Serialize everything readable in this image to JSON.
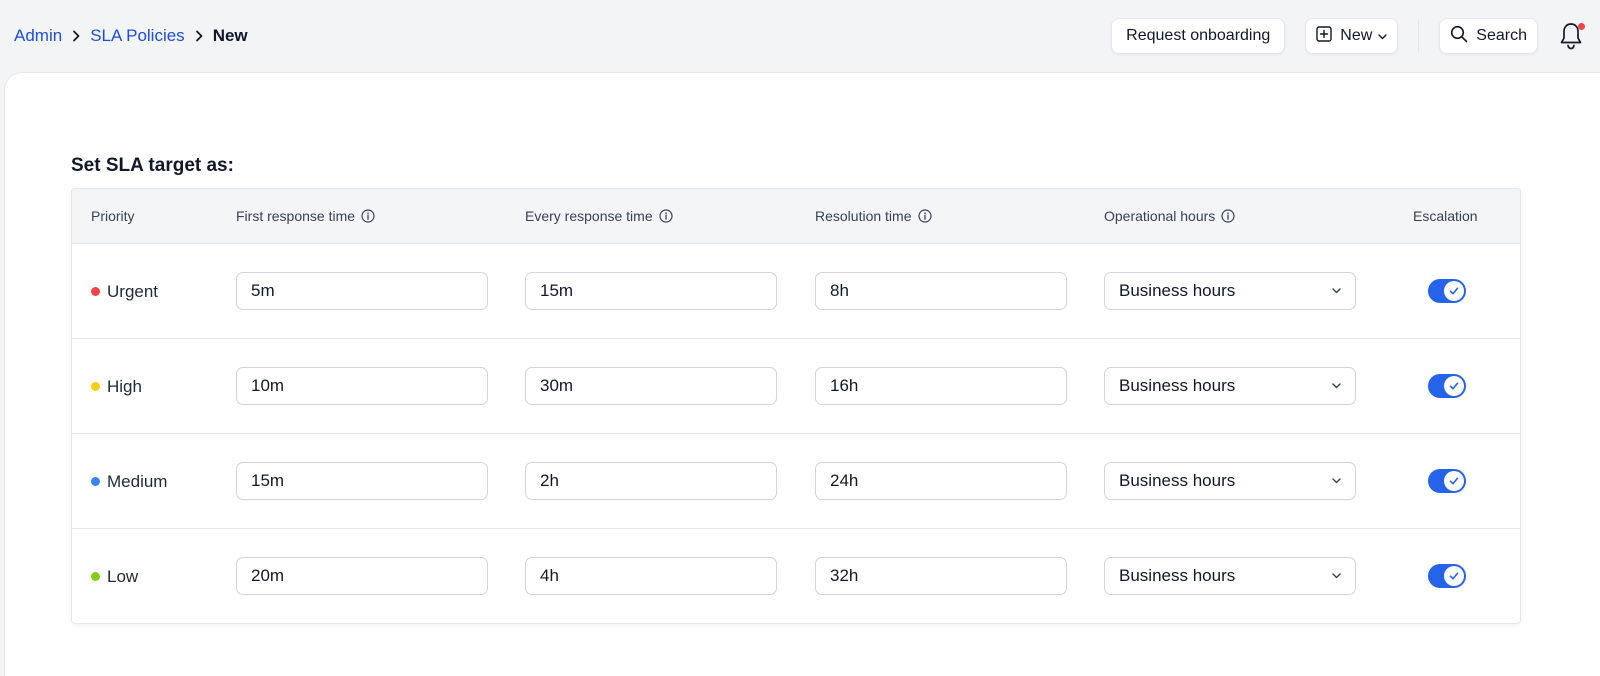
{
  "breadcrumb": {
    "admin": "Admin",
    "sla_policies": "SLA Policies",
    "current": "New"
  },
  "header": {
    "request_onboarding": "Request onboarding",
    "new_label": "New",
    "search_label": "Search"
  },
  "section_title": "Set SLA target as:",
  "table": {
    "columns": {
      "priority": "Priority",
      "first_response": "First response time",
      "every_response": "Every response time",
      "resolution": "Resolution time",
      "operational_hours": "Operational hours",
      "escalation": "Escalation"
    },
    "rows": [
      {
        "priority": "Urgent",
        "color": "#ef4444",
        "first_response": "5m",
        "every_response": "15m",
        "resolution": "8h",
        "operational_hours": "Business hours",
        "escalation": true
      },
      {
        "priority": "High",
        "color": "#facc15",
        "first_response": "10m",
        "every_response": "30m",
        "resolution": "16h",
        "operational_hours": "Business hours",
        "escalation": true
      },
      {
        "priority": "Medium",
        "color": "#3b82f6",
        "first_response": "15m",
        "every_response": "2h",
        "resolution": "24h",
        "operational_hours": "Business hours",
        "escalation": true
      },
      {
        "priority": "Low",
        "color": "#84cc16",
        "first_response": "20m",
        "every_response": "4h",
        "resolution": "32h",
        "operational_hours": "Business hours",
        "escalation": true
      }
    ]
  },
  "colors": {
    "accent": "#2563eb",
    "link": "#1d4ed8",
    "notification_dot": "#ef4444"
  }
}
